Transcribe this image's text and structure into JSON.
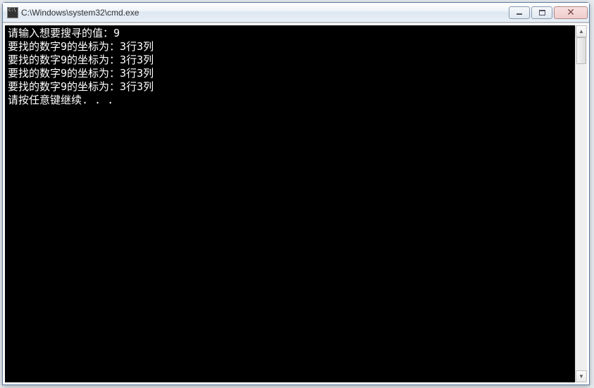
{
  "window": {
    "title": "C:\\Windows\\system32\\cmd.exe"
  },
  "console": {
    "lines": [
      "请输入想要搜寻的值：9",
      "要找的数字9的坐标为：3行3列",
      "要找的数字9的坐标为：3行3列",
      "要找的数字9的坐标为：3行3列",
      "要找的数字9的坐标为：3行3列",
      "请按任意键继续. . ."
    ]
  }
}
